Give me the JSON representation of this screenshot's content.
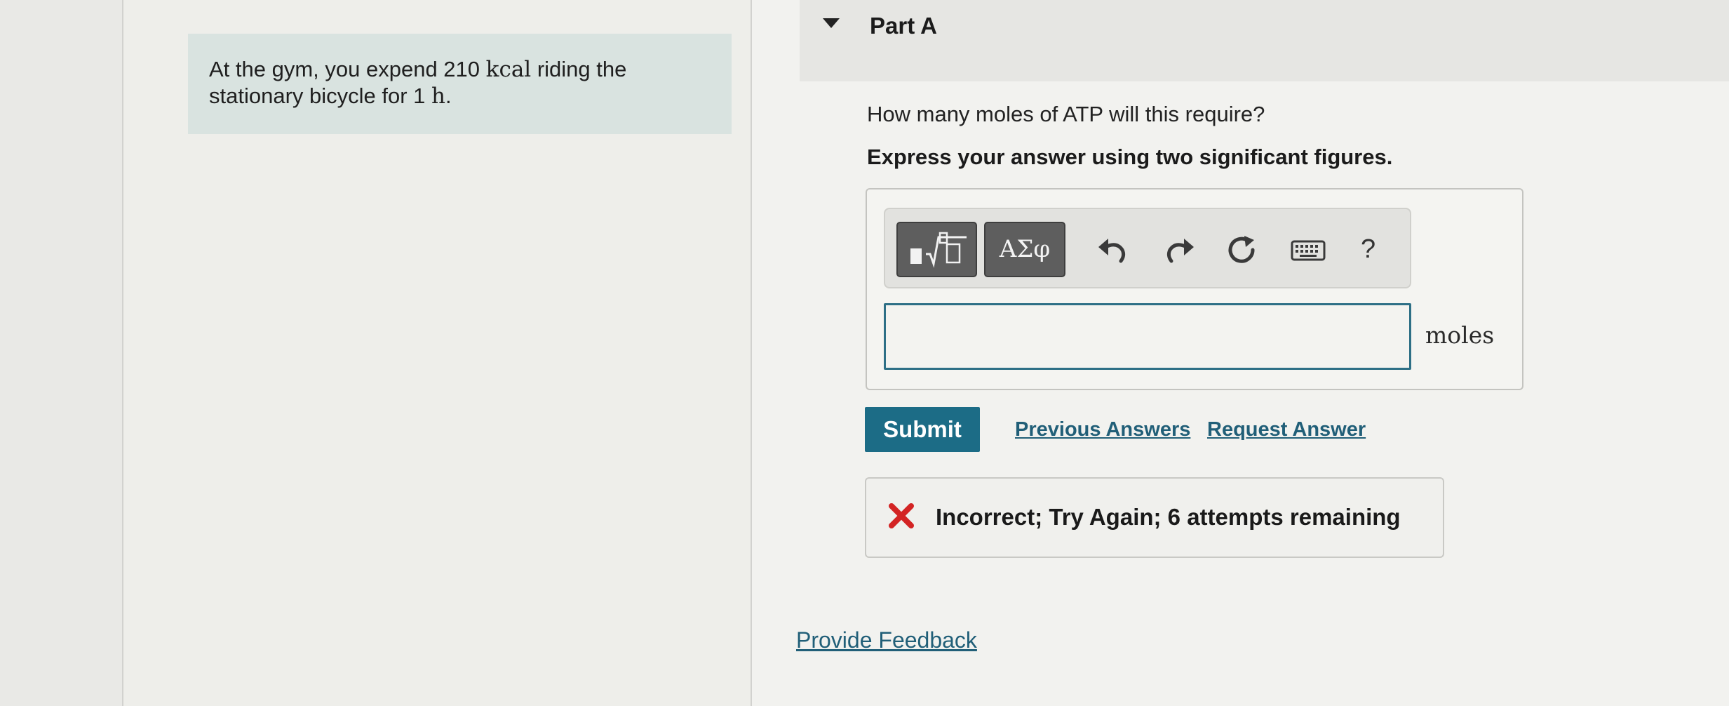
{
  "problem": {
    "text_before": "At the gym, you expend 210",
    "kcal_unit": "kcal",
    "text_middle": "riding the stationary bicycle for 1",
    "hour_unit": "h",
    "text_end": "."
  },
  "part": {
    "title": "Part A",
    "question": "How many moles of ATP will this require?",
    "instruction": "Express your answer using two significant figures."
  },
  "toolbar": {
    "templates_icon": "templates-icon",
    "greek_label": "ΑΣφ",
    "undo_icon": "undo-icon",
    "redo_icon": "redo-icon",
    "reset_icon": "reset-icon",
    "keyboard_icon": "keyboard-icon",
    "help_label": "?"
  },
  "answer": {
    "value": "",
    "unit": "moles"
  },
  "actions": {
    "submit_label": "Submit",
    "previous_answers_label": "Previous Answers",
    "request_answer_label": "Request Answer"
  },
  "feedback": {
    "message": "Incorrect; Try Again; 6 attempts remaining",
    "icon": "error-x-icon",
    "icon_color": "#d32424"
  },
  "footer": {
    "provide_feedback_label": "Provide Feedback"
  },
  "colors": {
    "accent": "#1c6c86",
    "link": "#215f78",
    "problem_bg": "#d9e3e0"
  }
}
